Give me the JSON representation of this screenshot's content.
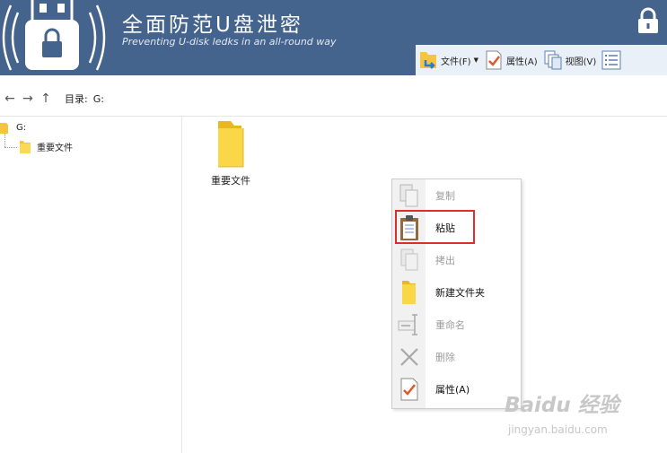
{
  "header": {
    "title": "全面防范U盘泄密",
    "subtitle": "Preventing U-disk ledks in an all-round way",
    "bg_color": "#44638d"
  },
  "toolbar": {
    "file_label": "文件(F)",
    "properties_label": "属性(A)",
    "view_label": "视图(V)"
  },
  "navbar": {
    "path_label": "目录:",
    "path_value": "G:"
  },
  "tree": {
    "root_label": "G:",
    "child_label": "重要文件"
  },
  "files": [
    {
      "name": "重要文件"
    }
  ],
  "context_menu": {
    "items": [
      {
        "label": "复制",
        "enabled": false,
        "icon": "copy-icon"
      },
      {
        "label": "粘贴",
        "enabled": true,
        "icon": "paste-icon"
      },
      {
        "label": "拷出",
        "enabled": false,
        "icon": "export-icon"
      },
      {
        "label": "新建文件夹",
        "enabled": true,
        "icon": "new-folder-icon"
      },
      {
        "label": "重命名",
        "enabled": false,
        "icon": "rename-icon"
      },
      {
        "label": "删除",
        "enabled": false,
        "icon": "delete-icon"
      },
      {
        "label": "属性(A)",
        "enabled": true,
        "icon": "properties-icon"
      }
    ],
    "highlight_color": "#d9302c"
  },
  "watermark": {
    "text": "Baidu 经验",
    "sub": "jingyan.baidu.com"
  }
}
